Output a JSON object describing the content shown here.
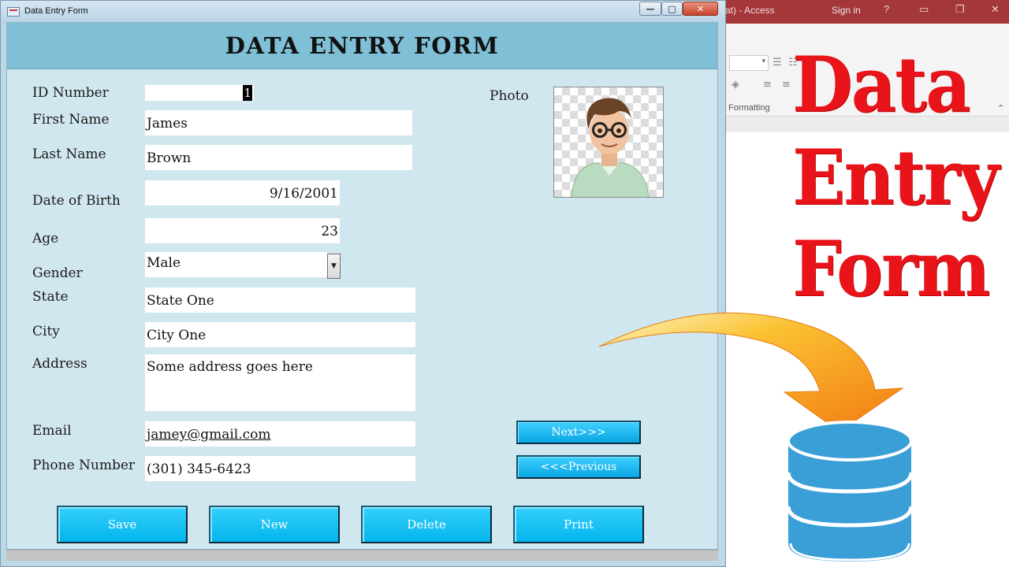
{
  "access": {
    "title_fragment": "at) - Access",
    "sign_in": "Sign in",
    "help_icon": "?",
    "ribbon_group": "Formatting"
  },
  "overlay_title": [
    "Data",
    "Entry",
    "Form"
  ],
  "window": {
    "title": "Data Entry Form",
    "controls": {
      "minimize": "—",
      "maximize": "□",
      "close": "✕"
    }
  },
  "form": {
    "heading": "DATA ENTRY FORM",
    "labels": {
      "id": "ID Number",
      "first_name": "First Name",
      "last_name": "Last Name",
      "dob": "Date of Birth",
      "age": "Age",
      "gender": "Gender",
      "state": "State",
      "city": "City",
      "address": "Address",
      "email": "Email",
      "phone": "Phone Number",
      "photo": "Photo"
    },
    "values": {
      "id": "1",
      "first_name": "James",
      "last_name": "Brown",
      "dob": "9/16/2001",
      "age": "23",
      "gender": "Male",
      "state": "State One",
      "city": "City One",
      "address": "Some address goes here",
      "email": "jamey@gmail.com",
      "phone": "(301) 345-6423"
    },
    "nav": {
      "next": "Next>>>",
      "previous": "<<<Previous"
    },
    "actions": {
      "save": "Save",
      "new": "New",
      "delete": "Delete",
      "print": "Print"
    }
  },
  "colors": {
    "access_brand": "#a4373a",
    "title_red": "#e8141a",
    "button_cyan": "#08b6ec",
    "form_header": "#7fc0d6",
    "form_body": "#d1e7ef",
    "arrow_orange": "#f7931e",
    "database_blue": "#3a9fd6"
  },
  "icons": [
    "form-window-icon",
    "minimize-icon",
    "maximize-icon",
    "close-icon",
    "dropdown-arrow-icon",
    "avatar-photo",
    "curved-arrow-icon",
    "database-icon"
  ]
}
